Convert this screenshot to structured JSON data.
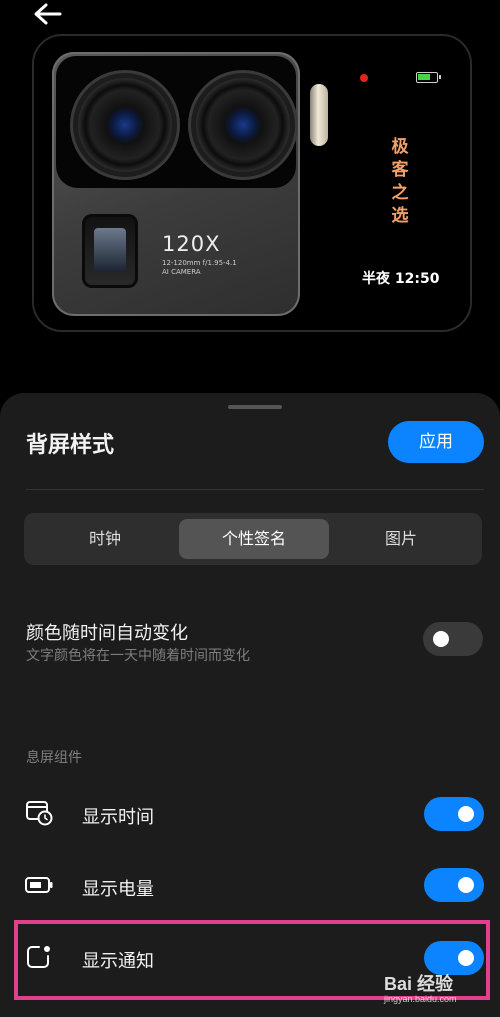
{
  "preview": {
    "zoom_label": "120X",
    "spec_line1": "12-120mm f/1.95-4.1",
    "spec_line2": "AI CAMERA",
    "signature": "极客之选",
    "clock": "半夜 12:50"
  },
  "sheet": {
    "title": "背屏样式",
    "apply_label": "应用",
    "tabs": [
      {
        "label": "时钟",
        "selected": false
      },
      {
        "label": "个性签名",
        "selected": true
      },
      {
        "label": "图片",
        "selected": false
      }
    ],
    "color_setting": {
      "title": "颜色随时间自动变化",
      "subtitle": "文字颜色将在一天中随着时间而变化",
      "enabled": false
    },
    "widgets_section": "息屏组件",
    "widgets": [
      {
        "label": "显示时间",
        "icon": "clock-calendar-icon",
        "enabled": true
      },
      {
        "label": "显示电量",
        "icon": "battery-icon",
        "enabled": true
      },
      {
        "label": "显示通知",
        "icon": "notification-icon",
        "enabled": true
      }
    ]
  },
  "watermark": {
    "brand": "Bai 经验",
    "url": "jingyan.baidu.com"
  },
  "colors": {
    "accent": "#0d84ff",
    "highlight": "#e0408c",
    "signature": "#f3a06b"
  }
}
